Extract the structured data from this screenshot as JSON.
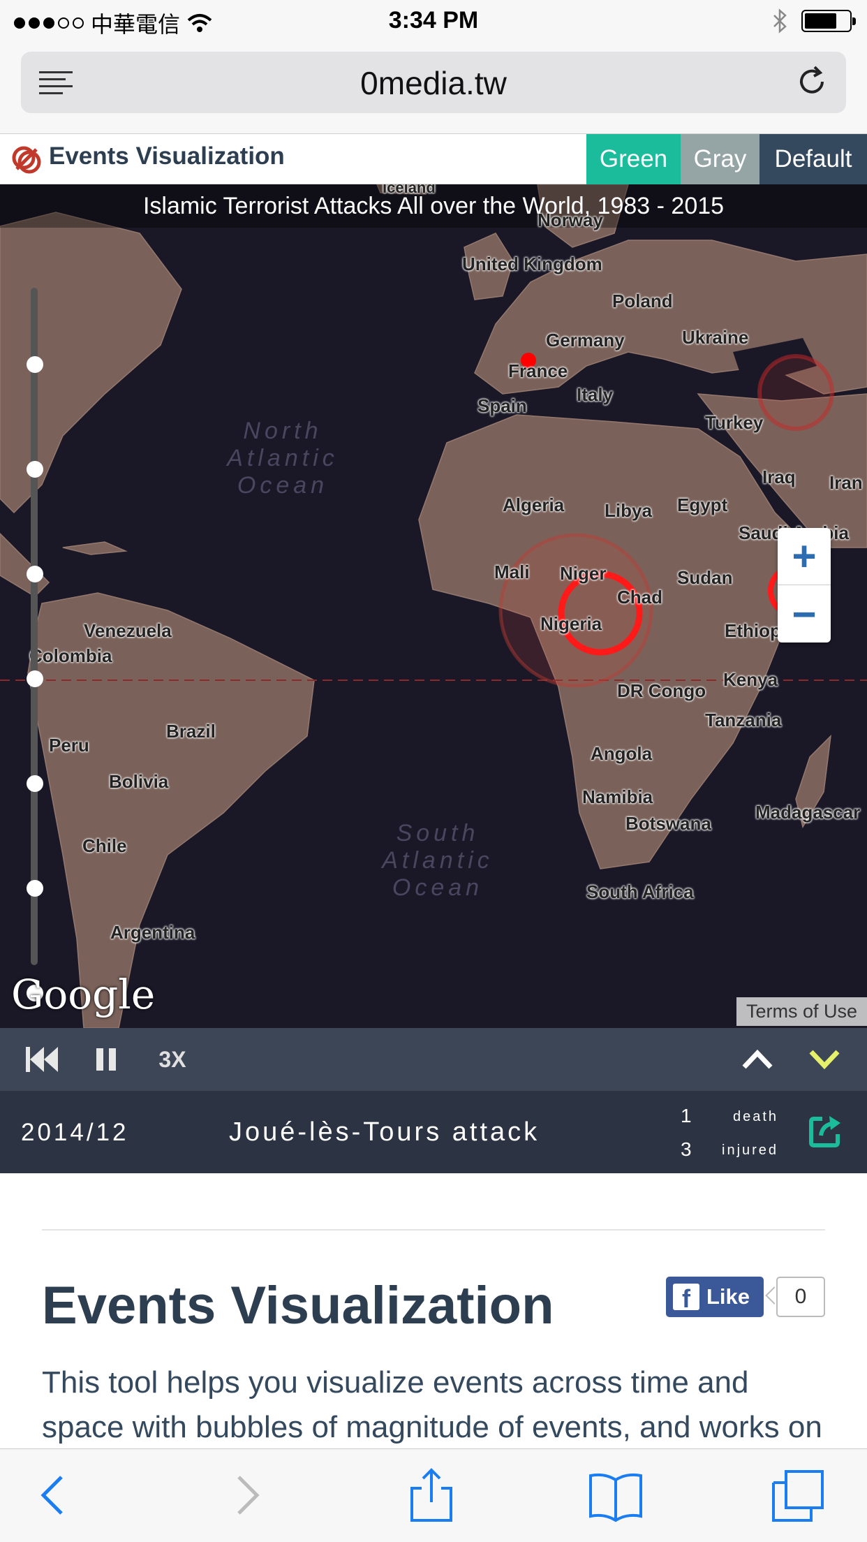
{
  "status_bar": {
    "carrier": "中華電信",
    "time": "3:34 PM"
  },
  "browser": {
    "url": "0media.tw"
  },
  "site": {
    "title": "Events Visualization",
    "themes": [
      "Green",
      "Gray",
      "Default"
    ]
  },
  "map": {
    "title": "Islamic Terrorist Attacks All over the World, 1983 - 2015",
    "countries": [
      "Norway",
      "United Kingdom",
      "Poland",
      "Germany",
      "Ukraine",
      "France",
      "Italy",
      "Spain",
      "Turkey",
      "Iraq",
      "Iran",
      "Algeria",
      "Libya",
      "Egypt",
      "Saudi Arabia",
      "Mali",
      "Niger",
      "Chad",
      "Sudan",
      "Nigeria",
      "Ethiopia",
      "DR Congo",
      "Kenya",
      "Tanzania",
      "Angola",
      "Namibia",
      "Botswana",
      "Madagascar",
      "South Africa",
      "Venezuela",
      "Colombia",
      "Brazil",
      "Peru",
      "Bolivia",
      "Chile",
      "Argentina",
      "Iceland"
    ],
    "oceans": [
      "North Atlantic Ocean",
      "South Atlantic Ocean"
    ],
    "google_logo": "Google",
    "terms": "Terms of Use",
    "zoom_in": "+",
    "zoom_out": "−"
  },
  "controls": {
    "speed": "3X"
  },
  "event": {
    "date": "2014/12",
    "name": "Joué-lès-Tours attack",
    "deaths": "1",
    "death_label": "death",
    "injured": "3",
    "injured_label": "injured"
  },
  "content": {
    "title": "Events Visualization",
    "like_label": "Like",
    "like_count": "0",
    "description": "This tool helps you visualize events across time and space with bubbles of magnitude of events, and works on"
  },
  "colors": {
    "green": "#1abc9c",
    "gray": "#95a5a6",
    "default": "#34495e",
    "event_marker": "#ff0000"
  }
}
